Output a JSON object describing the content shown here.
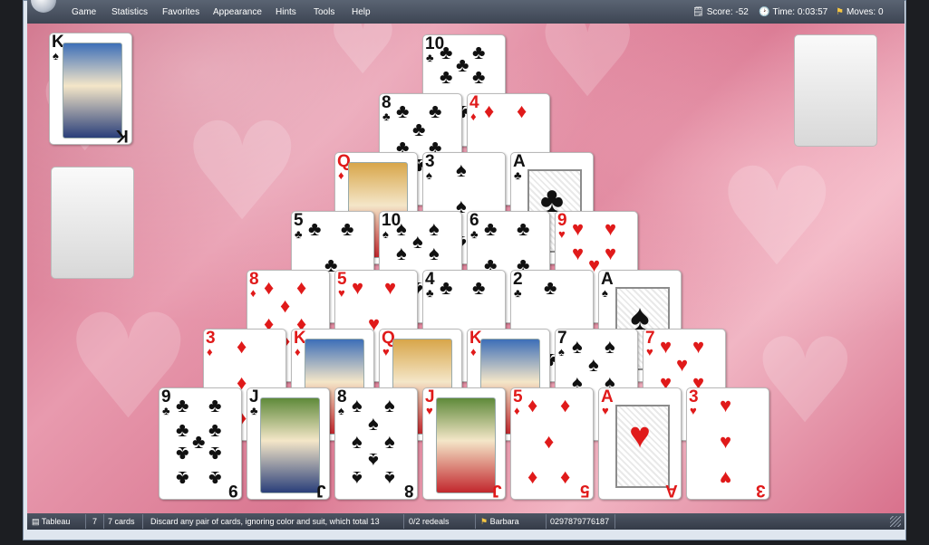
{
  "menu": {
    "items": [
      "Game",
      "Statistics",
      "Favorites",
      "Appearance",
      "Hints",
      "Tools",
      "Help"
    ]
  },
  "stats": {
    "score": "Score: -52",
    "time": "Time: 0:03:57",
    "moves": "Moves: 0"
  },
  "stock_card": {
    "rank": "K",
    "suit": "♠",
    "color": "black"
  },
  "pyramid": [
    [
      {
        "rank": "10",
        "suit": "♣",
        "color": "black"
      }
    ],
    [
      {
        "rank": "8",
        "suit": "♣",
        "color": "black"
      },
      {
        "rank": "4",
        "suit": "♦",
        "color": "red"
      }
    ],
    [
      {
        "rank": "Q",
        "suit": "♦",
        "color": "red"
      },
      {
        "rank": "3",
        "suit": "♠",
        "color": "black"
      },
      {
        "rank": "A",
        "suit": "♣",
        "color": "black"
      }
    ],
    [
      {
        "rank": "5",
        "suit": "♣",
        "color": "black"
      },
      {
        "rank": "10",
        "suit": "♠",
        "color": "black"
      },
      {
        "rank": "6",
        "suit": "♣",
        "color": "black"
      },
      {
        "rank": "9",
        "suit": "♥",
        "color": "red"
      }
    ],
    [
      {
        "rank": "8",
        "suit": "♦",
        "color": "red"
      },
      {
        "rank": "5",
        "suit": "♥",
        "color": "red"
      },
      {
        "rank": "4",
        "suit": "♣",
        "color": "black"
      },
      {
        "rank": "2",
        "suit": "♣",
        "color": "black"
      },
      {
        "rank": "A",
        "suit": "♠",
        "color": "black"
      }
    ],
    [
      {
        "rank": "3",
        "suit": "♦",
        "color": "red"
      },
      {
        "rank": "K",
        "suit": "♦",
        "color": "red"
      },
      {
        "rank": "Q",
        "suit": "♥",
        "color": "red"
      },
      {
        "rank": "K",
        "suit": "♦",
        "color": "red"
      },
      {
        "rank": "7",
        "suit": "♠",
        "color": "black"
      },
      {
        "rank": "7",
        "suit": "♥",
        "color": "red"
      }
    ],
    [
      {
        "rank": "9",
        "suit": "♣",
        "color": "black"
      },
      {
        "rank": "J",
        "suit": "♣",
        "color": "black"
      },
      {
        "rank": "8",
        "suit": "♠",
        "color": "black"
      },
      {
        "rank": "J",
        "suit": "♥",
        "color": "red"
      },
      {
        "rank": "5",
        "suit": "♦",
        "color": "red"
      },
      {
        "rank": "A",
        "suit": "♥",
        "color": "red"
      },
      {
        "rank": "3",
        "suit": "♥",
        "color": "red"
      }
    ]
  ],
  "status": {
    "game": "Tableau",
    "count": "7",
    "cards": "7 cards",
    "hint": "Discard any pair of cards, ignoring color and suit, which total 13",
    "redeals": "0/2 redeals",
    "player": "Barbara",
    "game_number": "0297879776187"
  },
  "colors": {
    "red": "#e01a1a",
    "black": "#111111",
    "menubar": "#4a5260"
  },
  "icons": {
    "score": "score-icon",
    "time": "clock-icon",
    "moves": "moves-icon",
    "app": "app-orb-icon"
  }
}
